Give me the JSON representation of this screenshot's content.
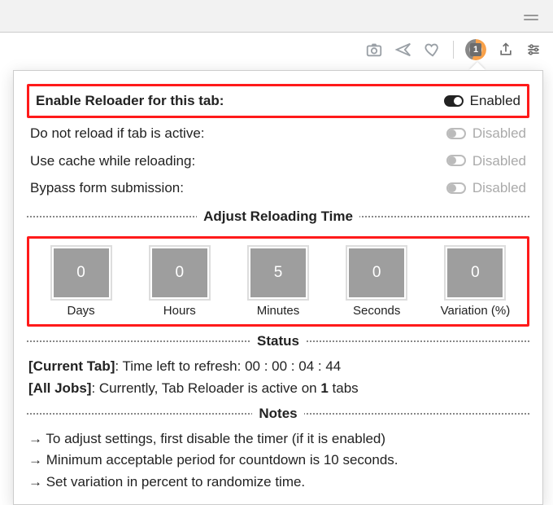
{
  "toolbar": {
    "notification_count": "1"
  },
  "options": {
    "enable": {
      "label": "Enable Reloader for this tab:",
      "state": "Enabled",
      "on": true
    },
    "noReloadActive": {
      "label": "Do not reload if tab is active:",
      "state": "Disabled",
      "on": false
    },
    "useCache": {
      "label": "Use cache while reloading:",
      "state": "Disabled",
      "on": false
    },
    "bypassForm": {
      "label": "Bypass form submission:",
      "state": "Disabled",
      "on": false
    }
  },
  "time": {
    "legend": "Adjust Reloading Time",
    "cells": {
      "days": {
        "value": "0",
        "label": "Days"
      },
      "hours": {
        "value": "0",
        "label": "Hours"
      },
      "minutes": {
        "value": "5",
        "label": "Minutes"
      },
      "seconds": {
        "value": "0",
        "label": "Seconds"
      },
      "variation": {
        "value": "0",
        "label": "Variation (%)"
      }
    }
  },
  "status": {
    "legend": "Status",
    "current_prefix": "[Current Tab]",
    "current_text": ": Time left to refresh: ",
    "current_time": "00 : 00 : 04 : 44",
    "all_prefix": "[All Jobs]",
    "all_text_a": ": Currently, Tab Reloader is active on ",
    "all_count": "1",
    "all_text_b": " tabs"
  },
  "notes": {
    "legend": "Notes",
    "n1": "→ To adjust settings, first disable the timer (if it is enabled)",
    "n2": "→ Minimum acceptable period for countdown is 10 seconds.",
    "n3": "→ Set variation in percent to randomize time."
  }
}
